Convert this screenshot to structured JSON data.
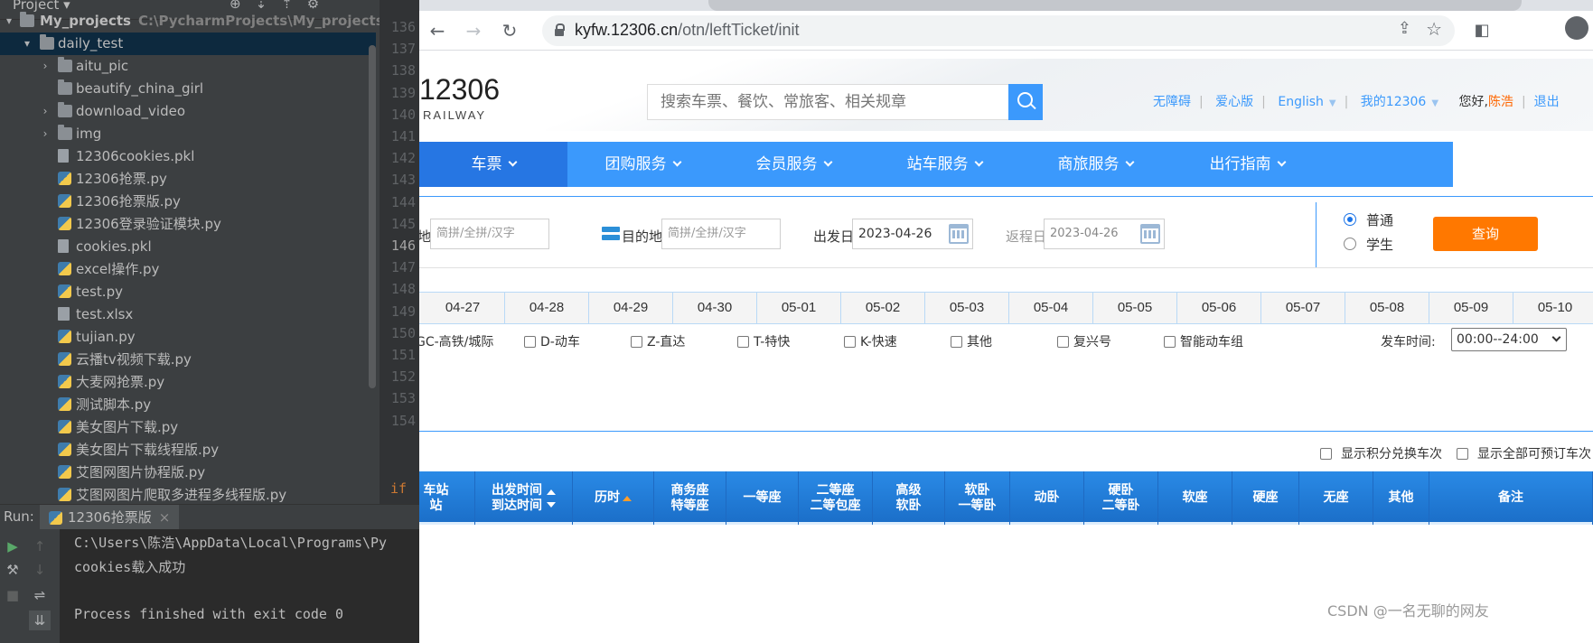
{
  "ide": {
    "project_label": "Project",
    "root_name": "My_projects",
    "root_path": "C:\\PycharmProjects\\My_projects",
    "tree": [
      {
        "name": "daily_test",
        "type": "folder",
        "depth": 1,
        "expanded": true,
        "selected": true
      },
      {
        "name": "aitu_pic",
        "type": "folder",
        "depth": 2,
        "collapsed": true
      },
      {
        "name": "beautify_china_girl",
        "type": "folder",
        "depth": 2
      },
      {
        "name": "download_video",
        "type": "folder",
        "depth": 2,
        "collapsed": true
      },
      {
        "name": "img",
        "type": "folder",
        "depth": 2,
        "collapsed": true
      },
      {
        "name": "12306cookies.pkl",
        "type": "file",
        "depth": 2
      },
      {
        "name": "12306抢票.py",
        "type": "py",
        "depth": 2
      },
      {
        "name": "12306抢票版.py",
        "type": "py",
        "depth": 2
      },
      {
        "name": "12306登录验证模块.py",
        "type": "py",
        "depth": 2
      },
      {
        "name": "cookies.pkl",
        "type": "file",
        "depth": 2
      },
      {
        "name": "excel操作.py",
        "type": "py",
        "depth": 2
      },
      {
        "name": "test.py",
        "type": "py",
        "depth": 2
      },
      {
        "name": "test.xlsx",
        "type": "xlsx",
        "depth": 2
      },
      {
        "name": "tujian.py",
        "type": "py",
        "depth": 2
      },
      {
        "name": "云播tv视频下载.py",
        "type": "py",
        "depth": 2
      },
      {
        "name": "大麦网抢票.py",
        "type": "py",
        "depth": 2
      },
      {
        "name": "测试脚本.py",
        "type": "py",
        "depth": 2
      },
      {
        "name": "美女图片下载.py",
        "type": "py",
        "depth": 2
      },
      {
        "name": "美女图片下载线程版.py",
        "type": "py",
        "depth": 2
      },
      {
        "name": "艾图网图片协程版.py",
        "type": "py",
        "depth": 2
      },
      {
        "name": "艾图网图片爬取多进程多线程版.py",
        "type": "py",
        "depth": 2
      }
    ],
    "line_numbers": [
      "136",
      "137",
      "138",
      "139",
      "140",
      "141",
      "142",
      "143",
      "144",
      "145",
      "146",
      "147",
      "148",
      "149",
      "150",
      "151",
      "152",
      "153",
      "154"
    ],
    "current_line": "146",
    "code_fragment": "if _",
    "run_label": "Run:",
    "run_tab": "12306抢票版",
    "console_lines": [
      "C:\\Users\\陈浩\\AppData\\Local\\Programs\\Py",
      "cookies载入成功",
      "",
      "Process finished with exit code 0"
    ]
  },
  "browser": {
    "url_host": "kyfw.12306.cn",
    "url_path": "/otn/leftTicket/init",
    "logo_text": "12306",
    "logo_sub": "RAILWAY",
    "search_placeholder": "搜索车票、餐饮、常旅客、相关规章",
    "top_links": [
      "无障碍",
      "爱心版",
      "English",
      "我的12306"
    ],
    "greeting": "您好,",
    "user_name": "陈浩",
    "logout": "退出",
    "nav": [
      "车票",
      "团购服务",
      "会员服务",
      "站车服务",
      "商旅服务",
      "出行指南"
    ],
    "query": {
      "from_label": "地",
      "from_placeholder": "简拼/全拼/汉字",
      "to_label": "目的地",
      "to_placeholder": "简拼/全拼/汉字",
      "depart_label": "出发日",
      "depart_value": "2023-04-26",
      "return_label": "返程日",
      "return_value": "2023-04-26",
      "ticket_types": [
        "普通",
        "学生"
      ],
      "selected_type": "普通",
      "query_button": "查询"
    },
    "dates": [
      "04-27",
      "04-28",
      "04-29",
      "04-30",
      "05-01",
      "05-02",
      "05-03",
      "05-04",
      "05-05",
      "05-06",
      "05-07",
      "05-08",
      "05-09",
      "05-10"
    ],
    "train_filters": [
      "GC-高铁/城际",
      "D-动车",
      "Z-直达",
      "T-特快",
      "K-快速",
      "其他",
      "复兴号",
      "智能动车组"
    ],
    "depart_time_label": "发车时间:",
    "depart_time_value": "00:00--24:00",
    "show_options": [
      "显示积分兑换车次",
      "显示全部可预订车次"
    ],
    "table_headers": [
      {
        "l1": "车站",
        "l2": "站"
      },
      {
        "l1": "出发时间",
        "l2": "到达时间"
      },
      {
        "l1": "历时",
        "l2": ""
      },
      {
        "l1": "商务座",
        "l2": "特等座"
      },
      {
        "l1": "一等座",
        "l2": ""
      },
      {
        "l1": "二等座",
        "l2": "二等包座"
      },
      {
        "l1": "高级",
        "l2": "软卧"
      },
      {
        "l1": "软卧",
        "l2": "一等卧"
      },
      {
        "l1": "动卧",
        "l2": ""
      },
      {
        "l1": "硬卧",
        "l2": "二等卧"
      },
      {
        "l1": "软座",
        "l2": ""
      },
      {
        "l1": "硬座",
        "l2": ""
      },
      {
        "l1": "无座",
        "l2": ""
      },
      {
        "l1": "其他",
        "l2": ""
      },
      {
        "l1": "备注",
        "l2": ""
      }
    ],
    "watermark": "CSDN @一名无聊的网友",
    "colors": {
      "brand_blue": "#3b99fc",
      "nav_active": "#2676e3",
      "query_orange": "#ff7800",
      "user_orange": "#ff6600"
    }
  }
}
